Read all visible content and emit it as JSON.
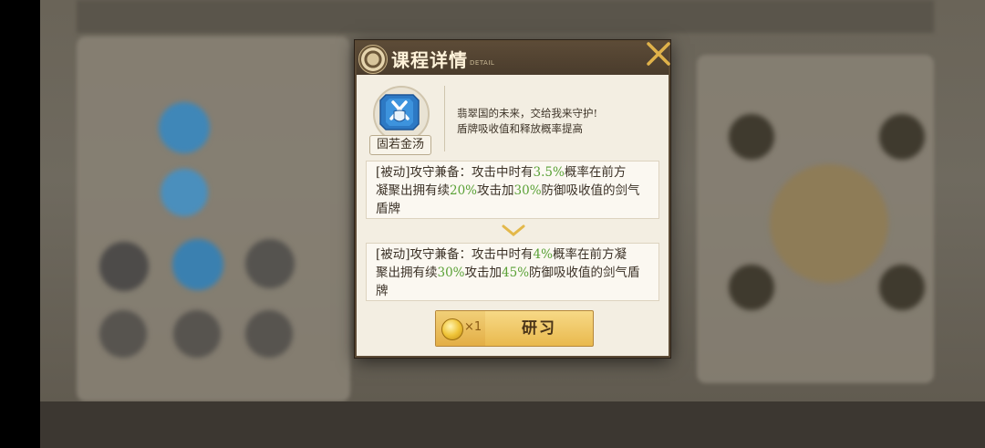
{
  "dialog": {
    "title": "课程详情",
    "subtitle": "DETAIL"
  },
  "skill": {
    "name": "固若金汤",
    "description_line1": "翡翠国的未来，交给我来守护!",
    "description_line2": "盾牌吸收值和释放概率提高"
  },
  "effect_current": {
    "l1_a": "[被动]攻守兼备：攻击中时有",
    "l1_pct": "3.5%",
    "l1_b": "概率在前方",
    "l2_a": "凝聚出拥有续",
    "l2_pct1": "20%",
    "l2_b": "攻击加",
    "l2_pct2": "30%",
    "l2_c": "防御吸收值的剑气",
    "l3": "盾牌"
  },
  "effect_next": {
    "l1_a": "[被动]攻守兼备：攻击中时有",
    "l1_pct": "4%",
    "l1_b": "概率在前方凝",
    "l2_a": "聚出拥有续",
    "l2_pct1": "30%",
    "l2_b": "攻击加",
    "l2_pct2": "45%",
    "l2_c": "防御吸收值的剑气盾",
    "l3": "牌"
  },
  "research_button": {
    "cost": "×1",
    "label": "研习"
  },
  "colors": {
    "highlight": "#5aa136",
    "header": "#4a3c2c",
    "button": "#e9b94e"
  }
}
